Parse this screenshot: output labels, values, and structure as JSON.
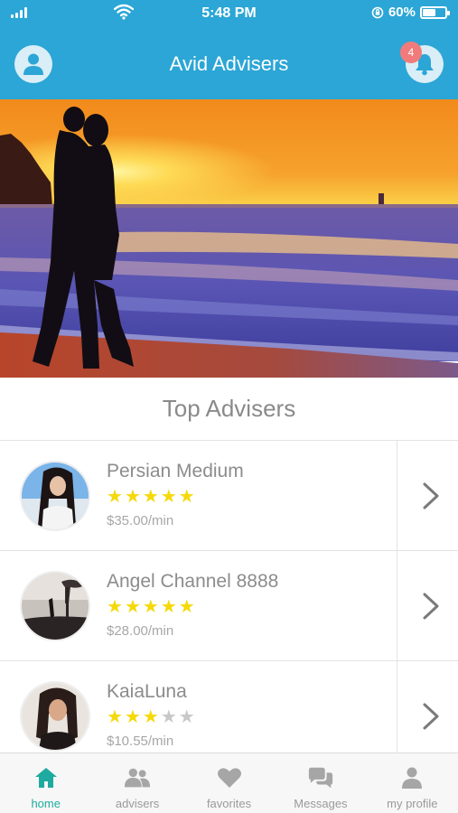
{
  "status_bar": {
    "time": "5:48 PM",
    "battery": "60%",
    "battery_level": 0.6
  },
  "header": {
    "title": "Avid Advisers",
    "notification_count": "4"
  },
  "section": {
    "title": "Top Advisers"
  },
  "advisers": [
    {
      "name": "Persian Medium",
      "rating": 5,
      "max_rating": 5,
      "price": "$35.00/min"
    },
    {
      "name": "Angel Channel 8888",
      "rating": 5,
      "max_rating": 5,
      "price": "$28.00/min"
    },
    {
      "name": "KaiaLuna",
      "rating": 3,
      "max_rating": 5,
      "price": "$10.55/min"
    }
  ],
  "tabs": [
    {
      "label": "home",
      "icon": "home-icon",
      "active": true
    },
    {
      "label": "advisers",
      "icon": "people-icon",
      "active": false
    },
    {
      "label": "favorites",
      "icon": "heart-icon",
      "active": false
    },
    {
      "label": "Messages",
      "icon": "chat-icon",
      "active": false
    },
    {
      "label": "my profile",
      "icon": "person-icon",
      "active": false
    }
  ],
  "colors": {
    "header": "#2ba6d6",
    "accent": "#1faa9f",
    "star_filled": "#f5d90a",
    "star_empty": "#c8c8c8",
    "badge": "#f17b7b"
  }
}
